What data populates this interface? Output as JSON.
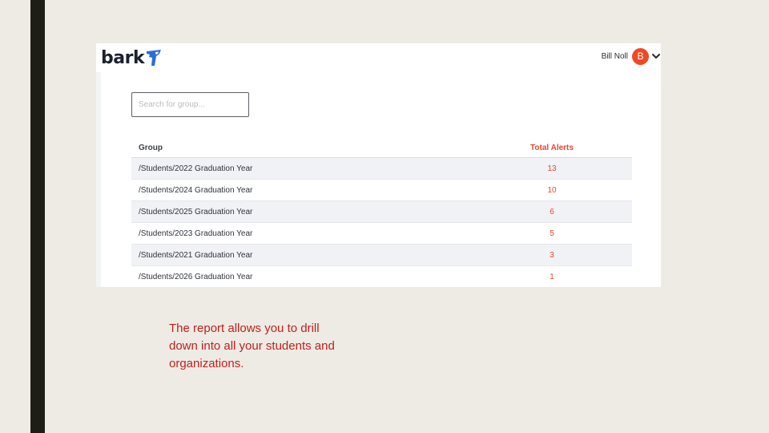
{
  "header": {
    "logo_text": "bark",
    "user_name": "Bill Noll",
    "avatar_initial": "B"
  },
  "search": {
    "placeholder": "Search for group..."
  },
  "table": {
    "columns": [
      "Group",
      "Total Alerts"
    ],
    "rows": [
      {
        "group": "/Students/2022 Graduation Year",
        "alerts": "13"
      },
      {
        "group": "/Students/2024 Graduation Year",
        "alerts": "10"
      },
      {
        "group": "/Students/2025 Graduation Year",
        "alerts": "6"
      },
      {
        "group": "/Students/2023 Graduation Year",
        "alerts": "5"
      },
      {
        "group": "/Students/2021 Graduation Year",
        "alerts": "3"
      },
      {
        "group": "/Students/2026 Graduation Year",
        "alerts": "1"
      }
    ]
  },
  "caption": {
    "line1": "The report allows you to drill",
    "line2": "down into all your students and",
    "line3": "organizations."
  },
  "colors": {
    "accent": "#e8462d",
    "avatar": "#ef4a24",
    "caption": "#c2201c",
    "logo_mark": "#2b6fd6",
    "left_bar": "#1d1e15",
    "slide_background": "#eeebe4"
  },
  "icons": {
    "logo_mark": "bark-dog-logo-icon",
    "user_menu": "chevron-down-icon"
  }
}
